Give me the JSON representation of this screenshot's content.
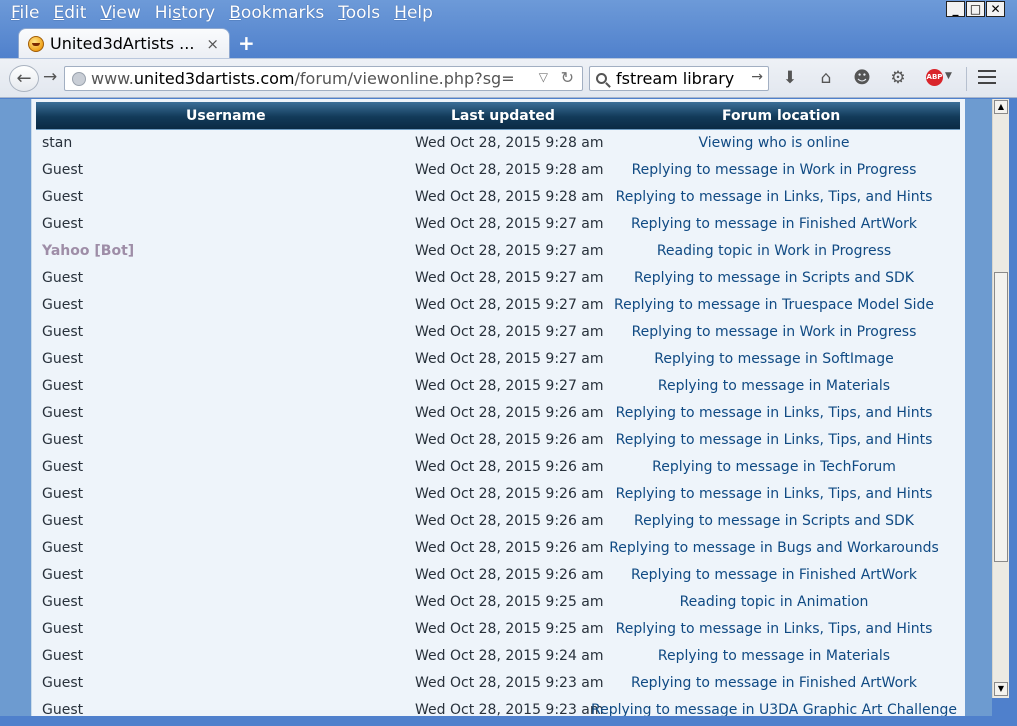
{
  "menubar": {
    "items": [
      {
        "label_u": "F",
        "label_rest": "ile"
      },
      {
        "label_u": "E",
        "label_rest": "dit"
      },
      {
        "label_u": "V",
        "label_rest": "iew"
      },
      {
        "label_pre": "Hi",
        "label_u": "s",
        "label_rest": "tory"
      },
      {
        "label_u": "B",
        "label_rest": "ookmarks"
      },
      {
        "label_u": "T",
        "label_rest": "ools"
      },
      {
        "label_u": "H",
        "label_rest": "elp"
      }
    ]
  },
  "window": {
    "minimize": "_",
    "maximize": "□",
    "close": "✕"
  },
  "tab": {
    "title": "United3dArtists ...",
    "close": "×",
    "new_tab": "+"
  },
  "navbar": {
    "url_prefix": "www.",
    "url_domain": "united3dartists.com",
    "url_path": "/forum/viewonline.php?sg=",
    "search_text": "fstream library",
    "icons": [
      "back-arrow-icon",
      "forward-arrow-icon",
      "globe-icon",
      "dropdown-icon",
      "reload-icon",
      "search-icon",
      "go-arrow-icon",
      "download-icon",
      "home-icon",
      "chat-smiley-icon",
      "gear-icon",
      "adblock-icon",
      "menu-icon"
    ],
    "adblock_label": "ABP"
  },
  "table": {
    "headers": {
      "username": "Username",
      "last_updated": "Last updated",
      "forum_location": "Forum location"
    },
    "rows": [
      {
        "user": "stan",
        "time": "Wed Oct 28, 2015 9:28 am",
        "loc": "Viewing who is online"
      },
      {
        "user": "Guest",
        "time": "Wed Oct 28, 2015 9:28 am",
        "loc": "Replying to message in Work in Progress"
      },
      {
        "user": "Guest",
        "time": "Wed Oct 28, 2015 9:28 am",
        "loc": "Replying to message in Links, Tips, and Hints"
      },
      {
        "user": "Guest",
        "time": "Wed Oct 28, 2015 9:27 am",
        "loc": "Replying to message in Finished ArtWork"
      },
      {
        "user": "Yahoo [Bot]",
        "time": "Wed Oct 28, 2015 9:27 am",
        "loc": "Reading topic in Work in Progress",
        "bot": true
      },
      {
        "user": "Guest",
        "time": "Wed Oct 28, 2015 9:27 am",
        "loc": "Replying to message in Scripts and SDK"
      },
      {
        "user": "Guest",
        "time": "Wed Oct 28, 2015 9:27 am",
        "loc": "Replying to message in Truespace Model Side"
      },
      {
        "user": "Guest",
        "time": "Wed Oct 28, 2015 9:27 am",
        "loc": "Replying to message in Work in Progress"
      },
      {
        "user": "Guest",
        "time": "Wed Oct 28, 2015 9:27 am",
        "loc": "Replying to message in SoftImage"
      },
      {
        "user": "Guest",
        "time": "Wed Oct 28, 2015 9:27 am",
        "loc": "Replying to message in Materials"
      },
      {
        "user": "Guest",
        "time": "Wed Oct 28, 2015 9:26 am",
        "loc": "Replying to message in Links, Tips, and Hints"
      },
      {
        "user": "Guest",
        "time": "Wed Oct 28, 2015 9:26 am",
        "loc": "Replying to message in Links, Tips, and Hints"
      },
      {
        "user": "Guest",
        "time": "Wed Oct 28, 2015 9:26 am",
        "loc": "Replying to message in TechForum"
      },
      {
        "user": "Guest",
        "time": "Wed Oct 28, 2015 9:26 am",
        "loc": "Replying to message in Links, Tips, and Hints"
      },
      {
        "user": "Guest",
        "time": "Wed Oct 28, 2015 9:26 am",
        "loc": "Replying to message in Scripts and SDK"
      },
      {
        "user": "Guest",
        "time": "Wed Oct 28, 2015 9:26 am",
        "loc": "Replying to message in Bugs and Workarounds"
      },
      {
        "user": "Guest",
        "time": "Wed Oct 28, 2015 9:26 am",
        "loc": "Replying to message in Finished ArtWork"
      },
      {
        "user": "Guest",
        "time": "Wed Oct 28, 2015 9:25 am",
        "loc": "Reading topic in Animation"
      },
      {
        "user": "Guest",
        "time": "Wed Oct 28, 2015 9:25 am",
        "loc": "Replying to message in Links, Tips, and Hints"
      },
      {
        "user": "Guest",
        "time": "Wed Oct 28, 2015 9:24 am",
        "loc": "Replying to message in Materials"
      },
      {
        "user": "Guest",
        "time": "Wed Oct 28, 2015 9:23 am",
        "loc": "Replying to message in Finished ArtWork"
      },
      {
        "user": "Guest",
        "time": "Wed Oct 28, 2015 9:23 am",
        "loc": "Replying to message in U3DA Graphic Art Challenge"
      }
    ]
  },
  "scrollbar": {
    "up": "▲",
    "down": "▼"
  }
}
